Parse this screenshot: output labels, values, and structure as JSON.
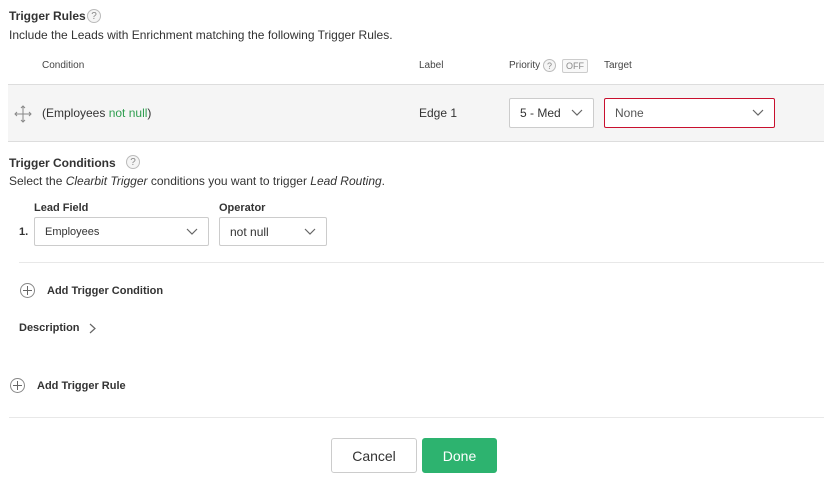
{
  "trigger_rules": {
    "title": "Trigger Rules",
    "help": "?",
    "description": "Include the Leads with Enrichment matching the following Trigger Rules.",
    "columns": {
      "condition": "Condition",
      "label": "Label",
      "priority": "Priority",
      "priority_help": "?",
      "priority_toggle": "OFF",
      "target": "Target"
    },
    "rule": {
      "condition_prefix": "(Employees ",
      "condition_op": "not null",
      "condition_suffix": ")",
      "label": "Edge 1",
      "priority_value": "5 - Med",
      "target_value": "None"
    }
  },
  "trigger_conditions": {
    "title": "Trigger Conditions",
    "help": "?",
    "desc_part1": "Select the ",
    "desc_em1": "Clearbit Trigger",
    "desc_part2": " conditions you want to trigger ",
    "desc_em2": "Lead Routing",
    "desc_part3": ".",
    "lead_field_label": "Lead Field",
    "operator_label": "Operator",
    "row_number": "1.",
    "lead_field_value": "Employees",
    "operator_value": "not null",
    "add_condition": "Add Trigger Condition",
    "description_toggle": "Description"
  },
  "add_rule": "Add Trigger Rule",
  "footer": {
    "cancel": "Cancel",
    "done": "Done"
  },
  "colors": {
    "accent_green": "#2db36f",
    "not_null_green": "#2e9e4f",
    "error_border": "#c8102e"
  }
}
